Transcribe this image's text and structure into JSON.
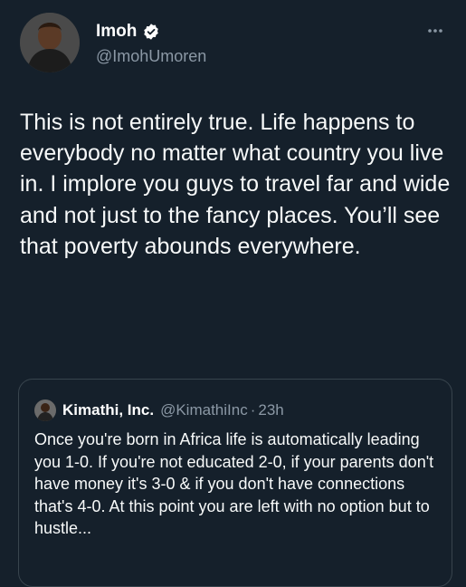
{
  "author": {
    "name": "Imoh",
    "handle": "@ImohUmoren"
  },
  "tweet": {
    "text": "This is not entirely true. Life happens to everybody no matter what country you live in. I implore you guys to travel far and wide and not just to the fancy places. You’ll see that poverty abounds everywhere."
  },
  "quoted": {
    "name": "Kimathi, Inc.",
    "handle": "@KimathiInc",
    "separator": "·",
    "time": "23h",
    "text": "Once you're born in Africa life is automatically leading you 1-0. If you're not educated 2-0, if your parents don't have money it's 3-0 & if you don't have connections that's 4-0. At this point you are left with no option but to hustle..."
  },
  "icons": {
    "verified": "verified-badge-icon",
    "more": "more-options-icon"
  },
  "colors": {
    "background": "#15202b",
    "secondary_text": "#8b98a5",
    "border": "#38444d",
    "verified_badge": "#ffffff"
  }
}
